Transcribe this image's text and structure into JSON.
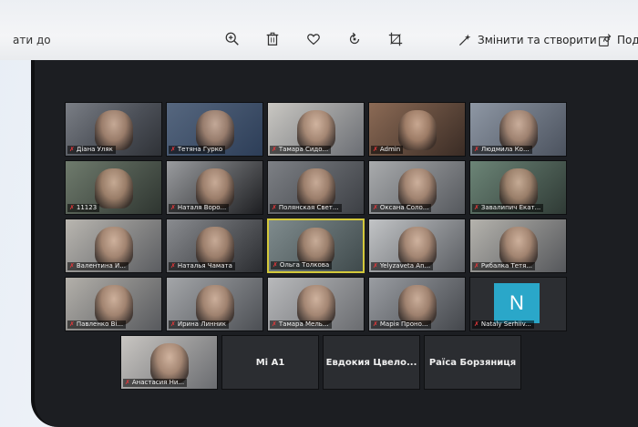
{
  "toolbar": {
    "back_label": "ати до",
    "edit_create_label": "Змінити та створити",
    "share_label": "Под"
  },
  "participants": [
    {
      "name": "Діана Уляк"
    },
    {
      "name": "Тетяна Гурко"
    },
    {
      "name": "Тамара Сидо..."
    },
    {
      "name": "Admin"
    },
    {
      "name": "Людмила Ко..."
    },
    {
      "name": "11123"
    },
    {
      "name": "Наталя Воро..."
    },
    {
      "name": "Полянская Свет..."
    },
    {
      "name": "Оксана Соло..."
    },
    {
      "name": "Завалипич Екат..."
    },
    {
      "name": "Валентина И..."
    },
    {
      "name": "Наталья Чамата"
    },
    {
      "name": "Ольга Толкова"
    },
    {
      "name": "Yelyzaveta An..."
    },
    {
      "name": "Рибалка Тетя..."
    },
    {
      "name": "Павленко Ві..."
    },
    {
      "name": "Ирина Линник"
    },
    {
      "name": "Тамара Мель..."
    },
    {
      "name": "Марія Проно..."
    },
    {
      "name": "Nataly Serhiiv...",
      "avatar_letter": "N"
    },
    {
      "name": "Анастасия Ни..."
    }
  ],
  "name_only_tiles": [
    "Mi A1",
    "Евдокия Цвело...",
    "Раїса Борзяниця"
  ],
  "colors": {
    "active_speaker": "#d4c93a",
    "muted_mic": "#e5383b",
    "avatar_bg": "#2aa7c9"
  }
}
